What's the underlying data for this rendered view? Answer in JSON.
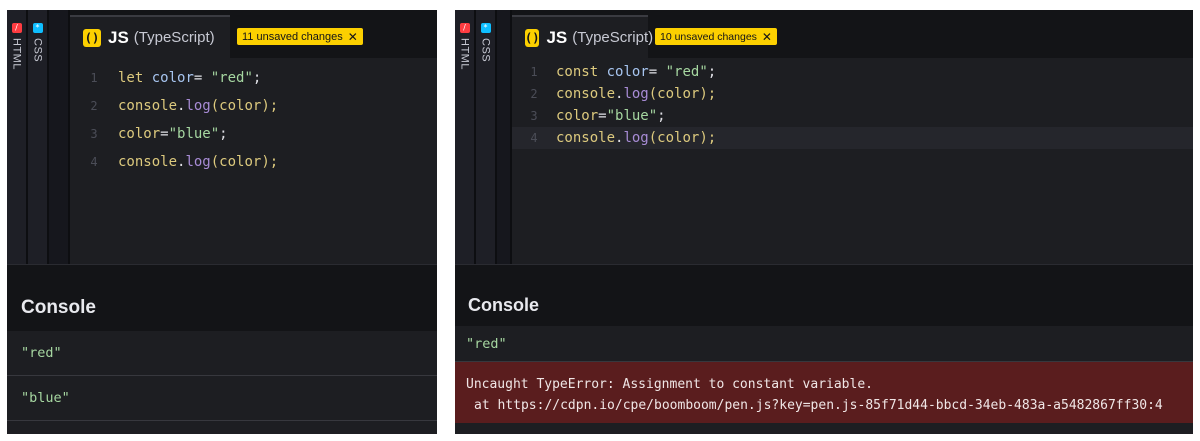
{
  "left_panel": {
    "side_tabs": [
      {
        "label": "HTML",
        "icon": "html-icon",
        "color": "#ff3c41"
      },
      {
        "label": "CSS",
        "icon": "css-icon",
        "color": "#0ebeff"
      }
    ],
    "editor": {
      "tab_icon_glyph": "()",
      "tab_name": "JS",
      "tab_lang": "(TypeScript)",
      "unsaved_badge": "11 unsaved changes",
      "lines": [
        {
          "num": "1",
          "tokens": [
            "let",
            " ",
            "color",
            "= ",
            "\"red\"",
            ";"
          ]
        },
        {
          "num": "2",
          "tokens": [
            "console",
            ".",
            "log",
            "(color);"
          ]
        },
        {
          "num": "3",
          "tokens": [
            "color",
            "=",
            "\"blue\"",
            ";"
          ]
        },
        {
          "num": "4",
          "tokens": [
            "console",
            ".",
            "log",
            "(color);"
          ]
        }
      ]
    },
    "console": {
      "title": "Console",
      "logs": [
        "\"red\"",
        "\"blue\""
      ]
    }
  },
  "right_panel": {
    "side_tabs": [
      {
        "label": "HTML",
        "icon": "html-icon",
        "color": "#ff3c41"
      },
      {
        "label": "CSS",
        "icon": "css-icon",
        "color": "#0ebeff"
      }
    ],
    "editor": {
      "tab_icon_glyph": "()",
      "tab_name": "JS",
      "tab_lang": "(TypeScript)",
      "unsaved_badge": "10 unsaved changes",
      "lines": [
        {
          "num": "1",
          "tokens": [
            "const",
            " ",
            "color",
            "= ",
            "\"red\"",
            ";"
          ]
        },
        {
          "num": "2",
          "tokens": [
            "console",
            ".",
            "log",
            "(color);"
          ]
        },
        {
          "num": "3",
          "tokens": [
            "color",
            "=",
            "\"blue\"",
            ";"
          ]
        },
        {
          "num": "4",
          "tokens": [
            "console",
            ".",
            "log",
            "(color);"
          ]
        }
      ]
    },
    "console": {
      "title": "Console",
      "logs": [
        "\"red\""
      ],
      "error_message": "Uncaught TypeError: Assignment to constant variable.",
      "error_location": "at https://cdpn.io/cpe/boomboom/pen.js?key=pen.js-85f71d44-bbcd-34eb-483a-a5482867ff30:4"
    }
  },
  "colors": {
    "accent_yellow": "#fcd000",
    "error_bg": "#5a1d1e",
    "string_green": "#a6d7a1"
  }
}
